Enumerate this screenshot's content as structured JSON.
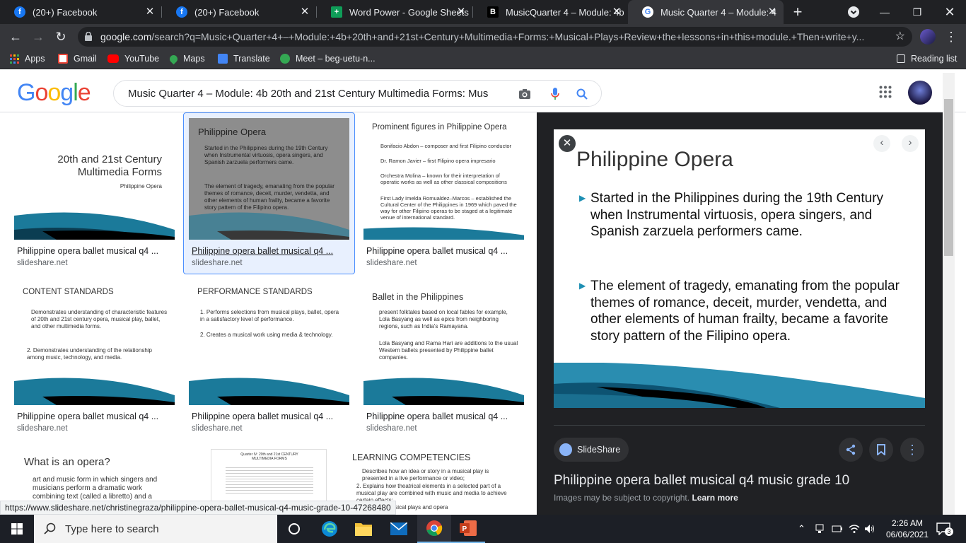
{
  "browser": {
    "tabs": [
      {
        "title": "(20+) Facebook",
        "icon": "facebook-icon",
        "color": "#1877f2"
      },
      {
        "title": "(20+) Facebook",
        "icon": "facebook-icon",
        "color": "#1877f2"
      },
      {
        "title": "Word Power - Google Sheets",
        "icon": "sheets-icon",
        "color": "#0f9d58"
      },
      {
        "title": "MusicQuarter 4 – Module: 4b",
        "icon": "brainly-icon",
        "color": "#000000"
      },
      {
        "title": "Music Quarter 4 – Module: 4",
        "icon": "google-icon",
        "color": "#4285f4"
      }
    ],
    "url_domain": "google.com",
    "url_rest": "/search?q=Music+Quarter+4+–+Module:+4b+20th+and+21st+Century+Multimedia+Forms:+Musical+Plays+Review+the+lessons+in+this+module.+Then+write+y...",
    "bookmarks": [
      "Apps",
      "Gmail",
      "YouTube",
      "Maps",
      "Translate",
      "Meet – beg-uetu-n..."
    ],
    "reading_list": "Reading list"
  },
  "google": {
    "query": "Music Quarter 4 – Module: 4b 20th and 21st Century Multimedia Forms: Mus"
  },
  "results": [
    {
      "caption": "Philippine opera ballet musical q4 ...",
      "domain": "slideshare.net"
    },
    {
      "caption": "Philippine opera ballet musical q4 ...",
      "domain": "slideshare.net"
    },
    {
      "caption": "Philippine opera ballet musical q4 ...",
      "domain": "slideshare.net"
    },
    {
      "caption": "Philippine opera ballet musical q4 ...",
      "domain": "slideshare.net"
    },
    {
      "caption": "Philippine opera ballet musical q4 ...",
      "domain": "slideshare.net"
    },
    {
      "caption": "Philippine opera ballet musical q4 ...",
      "domain": "slideshare.net"
    }
  ],
  "thumbs": {
    "t1_title": "20th and 21st Century Multimedia Forms",
    "t1_sub": "Philippine Opera",
    "t2_title": "Philippine Opera",
    "t2_b1": "Started in the Philippines during the 19th Century when Instrumental virtuosis, opera singers, and Spanish zarzuela performers came.",
    "t2_b2": "The element of tragedy, emanating from the popular themes of romance, deceit, murder, vendetta, and other elements of human frailty, became a favorite story pattern of the Filipino opera.",
    "t3_title": "Prominent figures in Philippine Opera",
    "t3_items": [
      "Bonifacio Abdon – composer and first Filipino conductor",
      "Dr. Ramon Javier – first Filipino opera impresario",
      "Orchestra Molina – known for their interpretation of operatic works as well as other classical compositions",
      "First Lady Imelda Romualdez–Marcos – established the Cultural Center of the Philippines in 1969 which paved the way for other Filipino operas to be staged at a legitimate venue of international standard."
    ],
    "t4_title": "CONTENT STANDARDS",
    "t4_items": [
      "Demonstrates understanding of characteristic features of 20th and 21st century opera, musical play, ballet, and other multimedia forms.",
      "2. Demonstrates understanding of the relationship among music, technology, and media."
    ],
    "t5_title": "PERFORMANCE STANDARDS",
    "t5_items": [
      "1. Performs selections from musical plays, ballet, opera in a satisfactory level of performance.",
      "2. Creates a musical work using media & technology."
    ],
    "t6_title": "Ballet in the Philippines",
    "t6_items": [
      "present folktales based on local fables for example, Lola Basyang as well as epics from neighboring regions, such as India's Ramayana.",
      "Lola Basyang and Rama Hari are additions to the usual Western ballets presented by Philippine ballet companies."
    ],
    "t7_title": "What is an opera?",
    "t7_item": "art and music form in which singers and musicians perform a dramatic work combining text (called a libretto) and a",
    "t8_title": "Quarter IV: 20th and 21st CENTURY MULTIMEDIA FORMS",
    "t9_title": "LEARNING COMPETENCIES",
    "t9_items": [
      "Describes how an idea or story in a musical play is presented in a live performance or video;",
      "2. Explains how theatrical elements in a selected part of a musical play are combined with music and media to achieve certain effects;",
      "ions from musical plays and opera"
    ]
  },
  "panel": {
    "slide_title": "Philippine Opera",
    "b1": "Started in the Philippines during the 19th Century  when Instrumental virtuosis, opera singers, and Spanish zarzuela performers came.",
    "b2": "The element of tragedy, emanating from the popular themes of romance, deceit, murder, vendetta, and other elements of human frailty, became a favorite story pattern of the Filipino opera.",
    "source": "SlideShare",
    "title": "Philippine opera ballet musical q4 music grade 10",
    "copyright": "Images may be subject to copyright.",
    "learn_more": "Learn more"
  },
  "status_url": "https://www.slideshare.net/christinegraza/philippine-opera-ballet-musical-q4-music-grade-10-47268480",
  "taskbar": {
    "search_placeholder": "Type here to search",
    "time": "2:26 AM",
    "date": "06/06/2021",
    "notifications": "3"
  }
}
